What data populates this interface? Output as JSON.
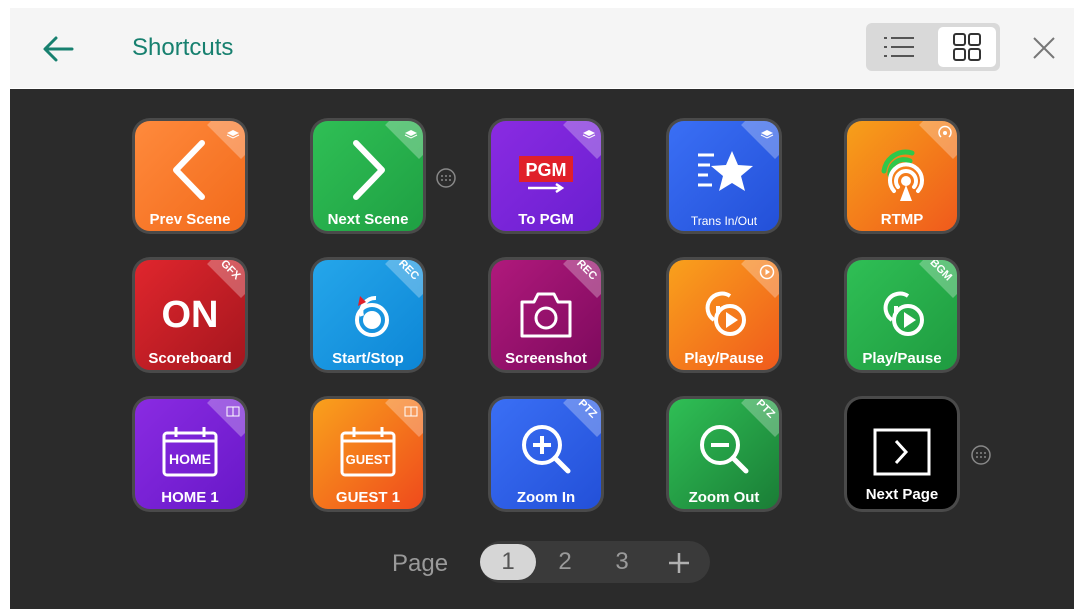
{
  "header": {
    "title": "Shortcuts",
    "back_icon": "arrow-left-icon",
    "list_view_icon": "list-view-icon",
    "grid_view_icon": "grid-view-icon",
    "close_icon": "close-icon",
    "accent_color": "#17806f"
  },
  "tiles": [
    {
      "label": "Prev Scene",
      "badge": "",
      "badge_icon": "layers-icon",
      "icon": "chevron-left-icon"
    },
    {
      "label": "Next Scene",
      "badge": "",
      "badge_icon": "layers-icon",
      "icon": "chevron-right-icon"
    },
    {
      "label": "To PGM",
      "badge": "",
      "badge_icon": "layers-icon",
      "icon": "pgm-icon",
      "icon_text": "PGM"
    },
    {
      "label": "Trans In/Out",
      "badge": "",
      "badge_icon": "layers-icon",
      "icon": "star-transition-icon"
    },
    {
      "label": "RTMP",
      "badge": "",
      "badge_icon": "broadcast-icon",
      "icon": "broadcast-icon"
    },
    {
      "label": "Scoreboard",
      "badge": "GFX",
      "icon": "on-text-icon",
      "icon_text": "ON"
    },
    {
      "label": "Start/Stop",
      "badge": "REC",
      "icon": "record-icon"
    },
    {
      "label": "Screenshot",
      "badge": "REC",
      "icon": "camera-icon"
    },
    {
      "label": "Play/Pause",
      "badge": "",
      "badge_icon": "play-circle-icon",
      "icon": "play-media-icon"
    },
    {
      "label": "Play/Pause",
      "badge": "BGM",
      "icon": "play-media-icon"
    },
    {
      "label": "HOME 1",
      "badge": "",
      "badge_icon": "scoreboard-icon",
      "icon": "calendar-home-icon",
      "icon_text": "HOME"
    },
    {
      "label": "GUEST 1",
      "badge": "",
      "badge_icon": "scoreboard-icon",
      "icon": "calendar-guest-icon",
      "icon_text": "GUEST"
    },
    {
      "label": "Zoom In",
      "badge": "PTZ",
      "icon": "zoom-in-icon"
    },
    {
      "label": "Zoom Out",
      "badge": "PTZ",
      "icon": "zoom-out-icon"
    },
    {
      "label": "Next Page",
      "badge": "",
      "icon": "next-page-icon"
    }
  ],
  "pager": {
    "label": "Page",
    "pages": [
      "1",
      "2",
      "3"
    ],
    "current": "1",
    "add_icon": "plus-icon"
  }
}
